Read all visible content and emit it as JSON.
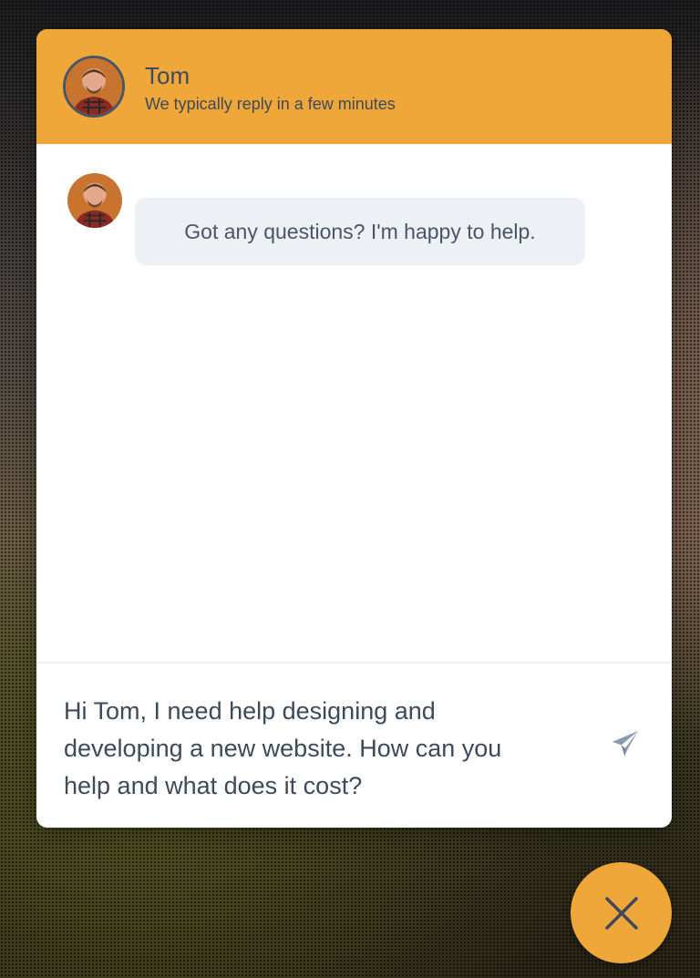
{
  "agent": {
    "name": "Tom",
    "status": "We typically reply in a few minutes"
  },
  "messages": [
    {
      "from": "agent",
      "text": "Got any questions? I'm happy to help."
    }
  ],
  "composer": {
    "value": "Hi Tom, I need help designing and\ndeveloping a new website. How can you\nhelp and what does it cost?"
  },
  "icons": {
    "send": "paper-plane-icon",
    "close": "close-icon"
  },
  "colors": {
    "accent": "#f0a73a",
    "text": "#3d4a5c",
    "bubble": "#edf1f5",
    "send_icon": "#8a9bb0"
  }
}
